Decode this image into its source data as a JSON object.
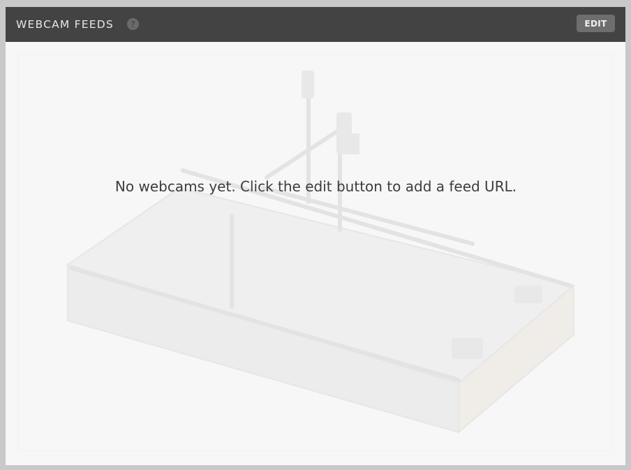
{
  "widget": {
    "title": "WEBCAM FEEDS",
    "help_icon": "question-circle-icon",
    "edit_label": "EDIT"
  },
  "feeds": {
    "empty_message": "No webcams yet. Click the edit button to add a feed URL.",
    "background_image": "cnc-machine-illustration"
  },
  "colors": {
    "header_bg": "#434343",
    "header_text": "#e6e6e6",
    "button_bg": "#6e6e6e",
    "panel_bg": "#f7f7f7",
    "message_text": "#3c3c3c"
  }
}
